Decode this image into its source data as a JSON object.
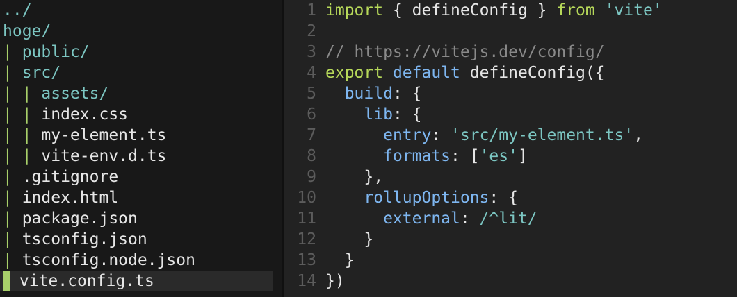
{
  "file_tree": {
    "rows": [
      {
        "guides": "",
        "label": "../",
        "kind": "dir"
      },
      {
        "guides": "",
        "label": "hoge/",
        "kind": "dir"
      },
      {
        "guides": "| ",
        "label": "public/",
        "kind": "dir"
      },
      {
        "guides": "| ",
        "label": "src/",
        "kind": "dir"
      },
      {
        "guides": "| | ",
        "label": "assets/",
        "kind": "dir"
      },
      {
        "guides": "| | ",
        "label": "index.css",
        "kind": "file"
      },
      {
        "guides": "| | ",
        "label": "my-element.ts",
        "kind": "file"
      },
      {
        "guides": "| | ",
        "label": "vite-env.d.ts",
        "kind": "file"
      },
      {
        "guides": "| ",
        "label": ".gitignore",
        "kind": "file"
      },
      {
        "guides": "| ",
        "label": "index.html",
        "kind": "file"
      },
      {
        "guides": "| ",
        "label": "package.json",
        "kind": "file"
      },
      {
        "guides": "| ",
        "label": "tsconfig.json",
        "kind": "file"
      },
      {
        "guides": "| ",
        "label": "tsconfig.node.json",
        "kind": "file"
      },
      {
        "guides": "",
        "label": "vite.config.ts",
        "kind": "file",
        "selected": true
      }
    ]
  },
  "editor": {
    "lines": [
      {
        "n": "1",
        "tokens": [
          [
            "kw",
            "import"
          ],
          [
            "plain",
            " { "
          ],
          [
            "fn",
            "defineConfig"
          ],
          [
            "plain",
            " } "
          ],
          [
            "kw",
            "from"
          ],
          [
            "plain",
            " "
          ],
          [
            "str",
            "'vite'"
          ]
        ]
      },
      {
        "n": "2",
        "tokens": []
      },
      {
        "n": "3",
        "tokens": [
          [
            "com",
            "// https://vitejs.dev/config/"
          ]
        ]
      },
      {
        "n": "4",
        "tokens": [
          [
            "kw",
            "export"
          ],
          [
            "plain",
            " "
          ],
          [
            "prop",
            "default"
          ],
          [
            "plain",
            " "
          ],
          [
            "fn",
            "defineConfig"
          ],
          [
            "plain",
            "({"
          ]
        ]
      },
      {
        "n": "5",
        "tokens": [
          [
            "plain",
            "  "
          ],
          [
            "prop",
            "build"
          ],
          [
            "plain",
            ": {"
          ]
        ]
      },
      {
        "n": "6",
        "tokens": [
          [
            "plain",
            "    "
          ],
          [
            "prop",
            "lib"
          ],
          [
            "plain",
            ": {"
          ]
        ]
      },
      {
        "n": "7",
        "tokens": [
          [
            "plain",
            "      "
          ],
          [
            "prop",
            "entry"
          ],
          [
            "plain",
            ": "
          ],
          [
            "str",
            "'src/my-element.ts'"
          ],
          [
            "plain",
            ","
          ]
        ]
      },
      {
        "n": "8",
        "tokens": [
          [
            "plain",
            "      "
          ],
          [
            "prop",
            "formats"
          ],
          [
            "plain",
            ": ["
          ],
          [
            "str",
            "'es'"
          ],
          [
            "plain",
            "]"
          ]
        ]
      },
      {
        "n": "9",
        "tokens": [
          [
            "plain",
            "    },"
          ]
        ]
      },
      {
        "n": "10",
        "tokens": [
          [
            "plain",
            "    "
          ],
          [
            "prop",
            "rollupOptions"
          ],
          [
            "plain",
            ": {"
          ]
        ]
      },
      {
        "n": "11",
        "tokens": [
          [
            "plain",
            "      "
          ],
          [
            "prop",
            "external"
          ],
          [
            "plain",
            ": "
          ],
          [
            "str",
            "/^lit/"
          ]
        ]
      },
      {
        "n": "12",
        "tokens": [
          [
            "plain",
            "    }"
          ]
        ]
      },
      {
        "n": "13",
        "tokens": [
          [
            "plain",
            "  }"
          ]
        ]
      },
      {
        "n": "14",
        "tokens": [
          [
            "plain",
            "})"
          ]
        ]
      }
    ]
  },
  "colors": {
    "keyword": "#b7d95a",
    "string": "#7cc6c2",
    "comment": "#8a8a8a",
    "property": "#7eb6f0",
    "guide": "#a8d06a",
    "directory": "#7cc6c2"
  }
}
